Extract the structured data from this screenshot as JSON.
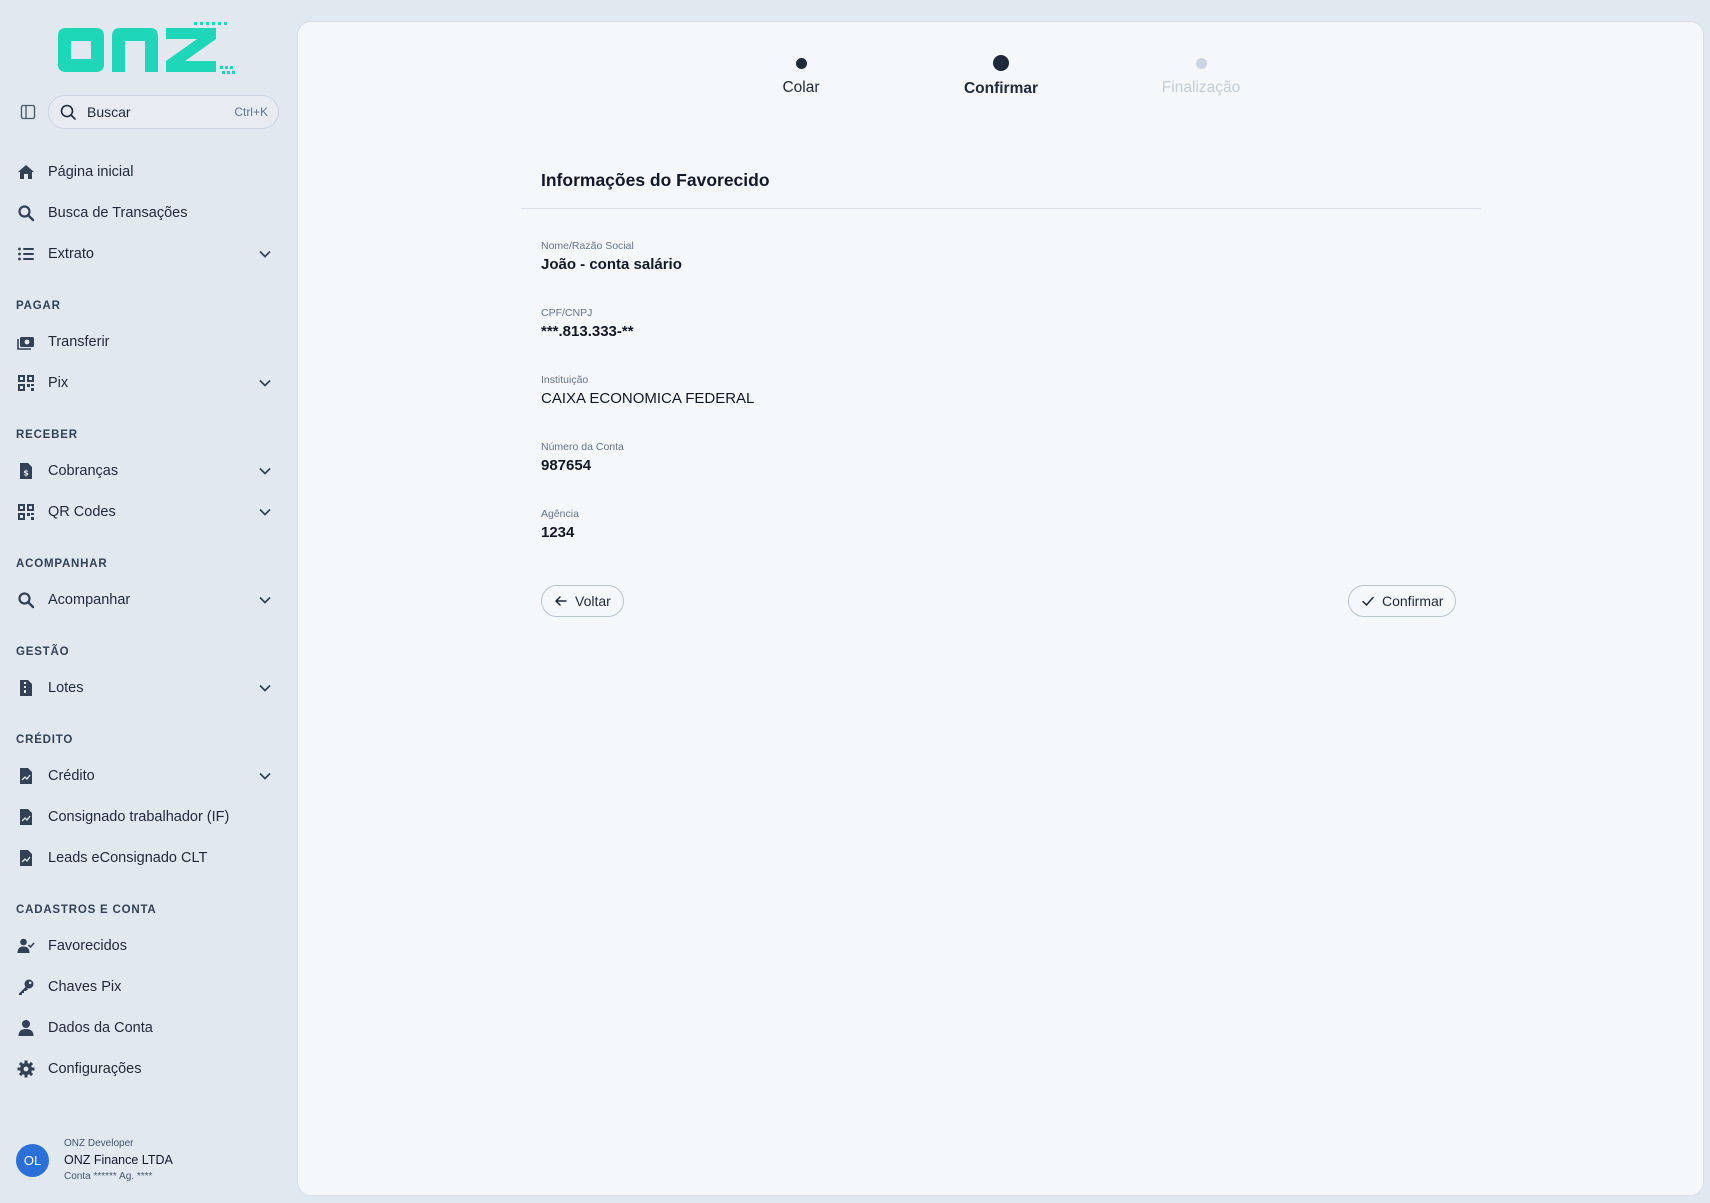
{
  "brand": {
    "logo_text": "onz",
    "accent": "#1ed6b8"
  },
  "search": {
    "label": "Buscar",
    "shortcut": "Ctrl+K",
    "icon": "search-icon"
  },
  "sidebar": {
    "top_items": [
      {
        "label": "Página inicial",
        "icon": "home-icon"
      },
      {
        "label": "Busca de Transações",
        "icon": "search-icon"
      },
      {
        "label": "Extrato",
        "icon": "list-icon",
        "expandable": true
      }
    ],
    "sections": [
      {
        "title": "PAGAR",
        "items": [
          {
            "label": "Transferir",
            "icon": "money-transfer-icon"
          },
          {
            "label": "Pix",
            "icon": "qr-code-icon",
            "expandable": true
          }
        ]
      },
      {
        "title": "RECEBER",
        "items": [
          {
            "label": "Cobranças",
            "icon": "invoice-icon",
            "expandable": true
          },
          {
            "label": "QR Codes",
            "icon": "qr-code-icon",
            "expandable": true
          }
        ]
      },
      {
        "title": "ACOMPANHAR",
        "items": [
          {
            "label": "Acompanhar",
            "icon": "search-icon",
            "expandable": true
          }
        ]
      },
      {
        "title": "GESTÃO",
        "items": [
          {
            "label": "Lotes",
            "icon": "file-zip-icon",
            "expandable": true
          }
        ]
      },
      {
        "title": "CRÉDITO",
        "items": [
          {
            "label": "Crédito",
            "icon": "document-chart-icon",
            "expandable": true
          },
          {
            "label": "Consignado trabalhador (IF)",
            "icon": "document-chart-icon"
          },
          {
            "label": "Leads eConsignado CLT",
            "icon": "document-chart-icon"
          }
        ]
      },
      {
        "title": "CADASTROS E CONTA",
        "items": [
          {
            "label": "Favorecidos",
            "icon": "user-check-icon"
          },
          {
            "label": "Chaves Pix",
            "icon": "key-icon"
          },
          {
            "label": "Dados da Conta",
            "icon": "user-icon"
          },
          {
            "label": "Configurações",
            "icon": "gear-icon"
          }
        ]
      }
    ]
  },
  "user": {
    "initials": "OL",
    "role": "ONZ Developer",
    "company": "ONZ Finance LTDA",
    "account": "Conta ****** Ag. ****"
  },
  "stepper": {
    "steps": [
      {
        "label": "Colar",
        "state": "done"
      },
      {
        "label": "Confirmar",
        "state": "active"
      },
      {
        "label": "Finalização",
        "state": "todo"
      }
    ]
  },
  "payee": {
    "heading": "Informações do Favorecido",
    "fields": [
      {
        "label": "Nome/Razão Social",
        "value": "João - conta salário"
      },
      {
        "label": "CPF/CNPJ",
        "value": "***.813.333-**"
      },
      {
        "label": "Instituição",
        "value": "CAIXA ECONOMICA FEDERAL"
      },
      {
        "label": "Número da Conta",
        "value": "987654"
      },
      {
        "label": "Agência",
        "value": "1234"
      }
    ]
  },
  "actions": {
    "back_label": "Voltar",
    "confirm_label": "Confirmar"
  }
}
